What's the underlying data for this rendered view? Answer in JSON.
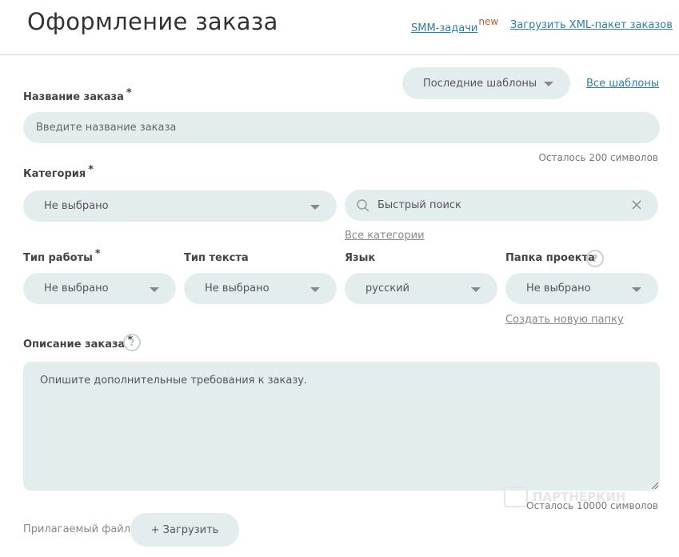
{
  "header": {
    "title": "Оформление заказа",
    "smm_link": "SMM-задачи",
    "smm_badge": "new",
    "xml_link": "Загрузить XML-пакет заказов"
  },
  "templates": {
    "select_label": "Последние шаблоны",
    "all_link": "Все шаблоны"
  },
  "order_name": {
    "label": "Название заказа",
    "required": "*",
    "placeholder": "Введите название заказа",
    "remaining": "Осталось 200 символов"
  },
  "category": {
    "label": "Категория",
    "required": "*",
    "value": "Не выбрано",
    "search_placeholder": "Быстрый поиск",
    "all_link": "Все категории"
  },
  "work_type": {
    "label": "Тип работы",
    "required": "*",
    "value": "Не выбрано"
  },
  "text_type": {
    "label": "Тип текста",
    "value": "Не выбрано"
  },
  "language": {
    "label": "Язык",
    "value": "русский"
  },
  "project_folder": {
    "label": "Папка проекта",
    "value": "Не выбрано",
    "help": "?",
    "create_link": "Создать новую папку"
  },
  "description": {
    "label": "Описание заказа",
    "required": "*",
    "help": "?",
    "placeholder": "Опишите дополнительные требования к заказу.",
    "remaining": "Осталось 10000 символов"
  },
  "attachment": {
    "label": "Прилагаемый файл",
    "upload_button": "+ Загрузить"
  },
  "watermark": "ПАРТНЕРКИН",
  "colors": {
    "field_bg": "#e4edee",
    "link": "#2a7fa8",
    "badge": "#e0532c",
    "text": "#444444"
  }
}
